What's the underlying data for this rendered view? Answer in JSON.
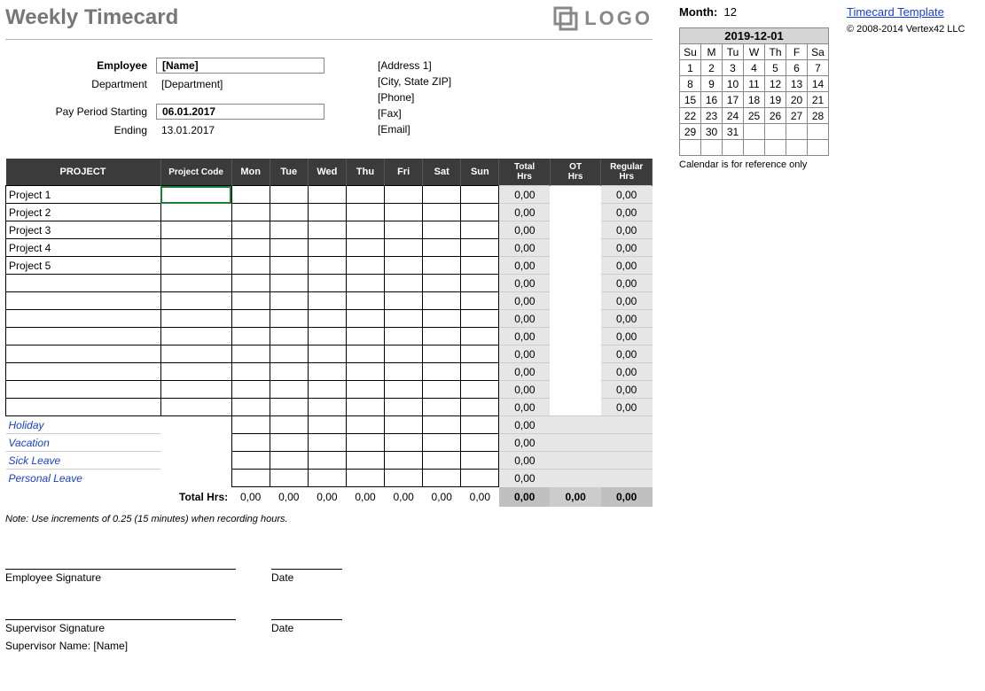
{
  "title": "Weekly Timecard",
  "logo_text": "LOGO",
  "month_label": "Month:",
  "month_value": "12",
  "link_text": "Timecard Template",
  "copyright": "© 2008-2014 Vertex42 LLC",
  "employee": {
    "label": "Employee",
    "value": "[Name]",
    "dept_label": "Department",
    "dept_value": "[Department]",
    "start_label": "Pay Period Starting",
    "start_value": "06.01.2017",
    "end_label": "Ending",
    "end_value": "13.01.2017"
  },
  "address": {
    "line1": "[Address 1]",
    "line2": "[City, State  ZIP]",
    "line3": "[Phone]",
    "line4": "[Fax]",
    "line5": "[Email]"
  },
  "headers": {
    "project": "PROJECT",
    "code": "Project Code",
    "days": [
      "Mon",
      "Tue",
      "Wed",
      "Thu",
      "Fri",
      "Sat",
      "Sun"
    ],
    "total": "Total",
    "hrs": "Hrs",
    "ot": "OT",
    "reg": "Regular"
  },
  "projects": [
    "Project 1",
    "Project 2",
    "Project 3",
    "Project 4",
    "Project 5",
    "",
    "",
    "",
    "",
    "",
    "",
    "",
    ""
  ],
  "leave": [
    "Holiday",
    "Vacation",
    "Sick Leave",
    "Personal Leave"
  ],
  "zero": "0,00",
  "totals_label": "Total Hrs:",
  "note": "Note: Use increments of 0.25 (15 minutes) when recording hours.",
  "sign": {
    "emp": "Employee Signature",
    "sup": "Supervisor Signature",
    "date": "Date",
    "supname": "Supervisor Name: [Name]"
  },
  "calendar": {
    "caption": "2019-12-01",
    "days": [
      "Su",
      "M",
      "Tu",
      "W",
      "Th",
      "F",
      "Sa"
    ],
    "weeks": [
      [
        "1",
        "2",
        "3",
        "4",
        "5",
        "6",
        "7"
      ],
      [
        "8",
        "9",
        "10",
        "11",
        "12",
        "13",
        "14"
      ],
      [
        "15",
        "16",
        "17",
        "18",
        "19",
        "20",
        "21"
      ],
      [
        "22",
        "23",
        "24",
        "25",
        "26",
        "27",
        "28"
      ],
      [
        "29",
        "30",
        "31",
        "",
        "",
        "",
        ""
      ],
      [
        "",
        "",
        "",
        "",
        "",
        "",
        ""
      ]
    ],
    "note": "Calendar is for reference only"
  }
}
